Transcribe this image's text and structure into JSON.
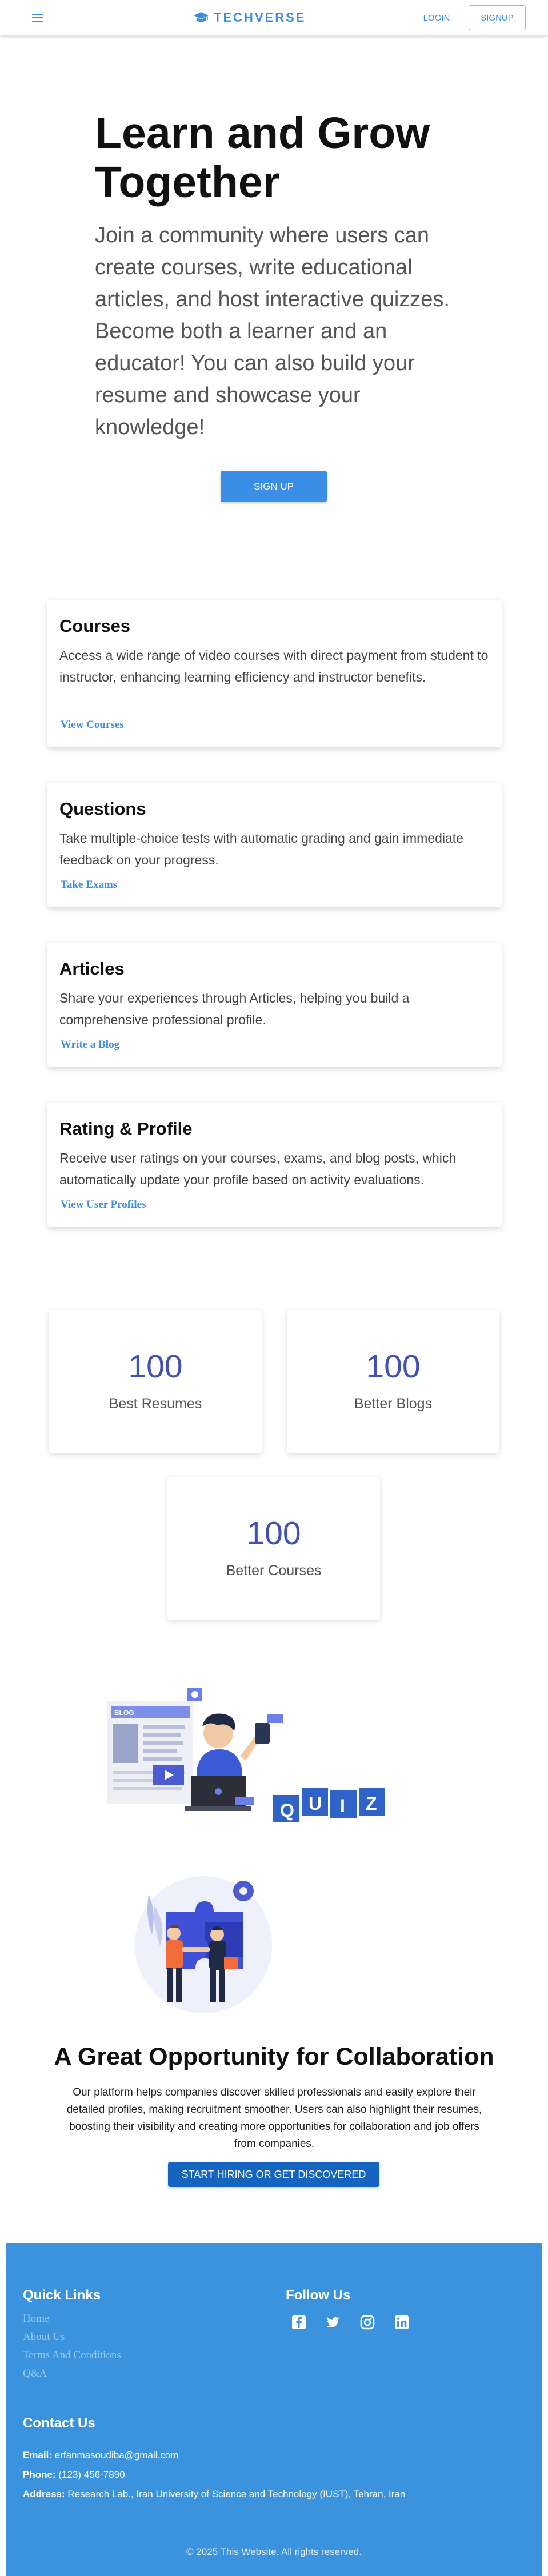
{
  "header": {
    "brand": "TECHVERSE",
    "login_label": "LOGIN",
    "signup_label": "SIGNUP"
  },
  "hero": {
    "title": "Learn and Grow Together",
    "subtitle": "Join a community where users can create courses, write educational articles, and host interactive quizzes. Become both a learner and an educator! You can also build your resume and showcase your knowledge!",
    "cta_label": "SIGN UP"
  },
  "features": [
    {
      "title": "Courses",
      "description": "Access a wide range of video courses with direct payment from student to instructor, enhancing learning efficiency and instructor benefits.",
      "link": "View Courses"
    },
    {
      "title": "Questions",
      "description": "Take multiple-choice tests with automatic grading and gain immediate feedback on your progress.",
      "link": "Take Exams"
    },
    {
      "title": "Articles",
      "description": "Share your experiences through Articles, helping you build a comprehensive professional profile.",
      "link": "Write a Blog"
    },
    {
      "title": "Rating & Profile",
      "description": "Receive user ratings on your courses, exams, and blog posts, which automatically update your profile based on activity evaluations.",
      "link": "View User Profiles"
    }
  ],
  "stats": [
    {
      "value": "100",
      "label": "Best Resumes"
    },
    {
      "value": "100",
      "label": "Better Blogs"
    },
    {
      "value": "100",
      "label": "Better Courses"
    }
  ],
  "illustrations": {
    "quiz_letters": [
      "Q",
      "U",
      "I",
      "Z"
    ],
    "blog_tag": "BLOG"
  },
  "collaboration": {
    "title": "A Great Opportunity for Collaboration",
    "text": "Our platform helps companies discover skilled professionals and easily explore their detailed profiles, making recruitment smoother. Users can also highlight their resumes, boosting their visibility and creating more opportunities for collaboration and job offers from companies.",
    "cta_label": "START HIRING OR GET DISCOVERED"
  },
  "footer": {
    "quick_links_title": "Quick Links",
    "quick_links": [
      "Home",
      "About Us",
      "Terms And Conditions",
      "Q&A"
    ],
    "follow_title": "Follow Us",
    "social_icons": [
      "facebook-icon",
      "twitter-icon",
      "instagram-icon",
      "linkedin-icon"
    ],
    "contact_title": "Contact Us",
    "email_label": "Email:",
    "email": "erfanmasoudiba@gmail.com",
    "phone_label": "Phone:",
    "phone": "(123) 456-7890",
    "address_label": "Address:",
    "address": "Research Lab., Iran University of Science and Technology (IUST), Tehran, Iran",
    "copyright": "© 2025 This Website. All rights reserved."
  },
  "colors": {
    "primary": "#3a8ee6",
    "stat_number": "#3f51b5",
    "footer_bg": "#3a93dc",
    "collab_button": "#1565c0"
  }
}
